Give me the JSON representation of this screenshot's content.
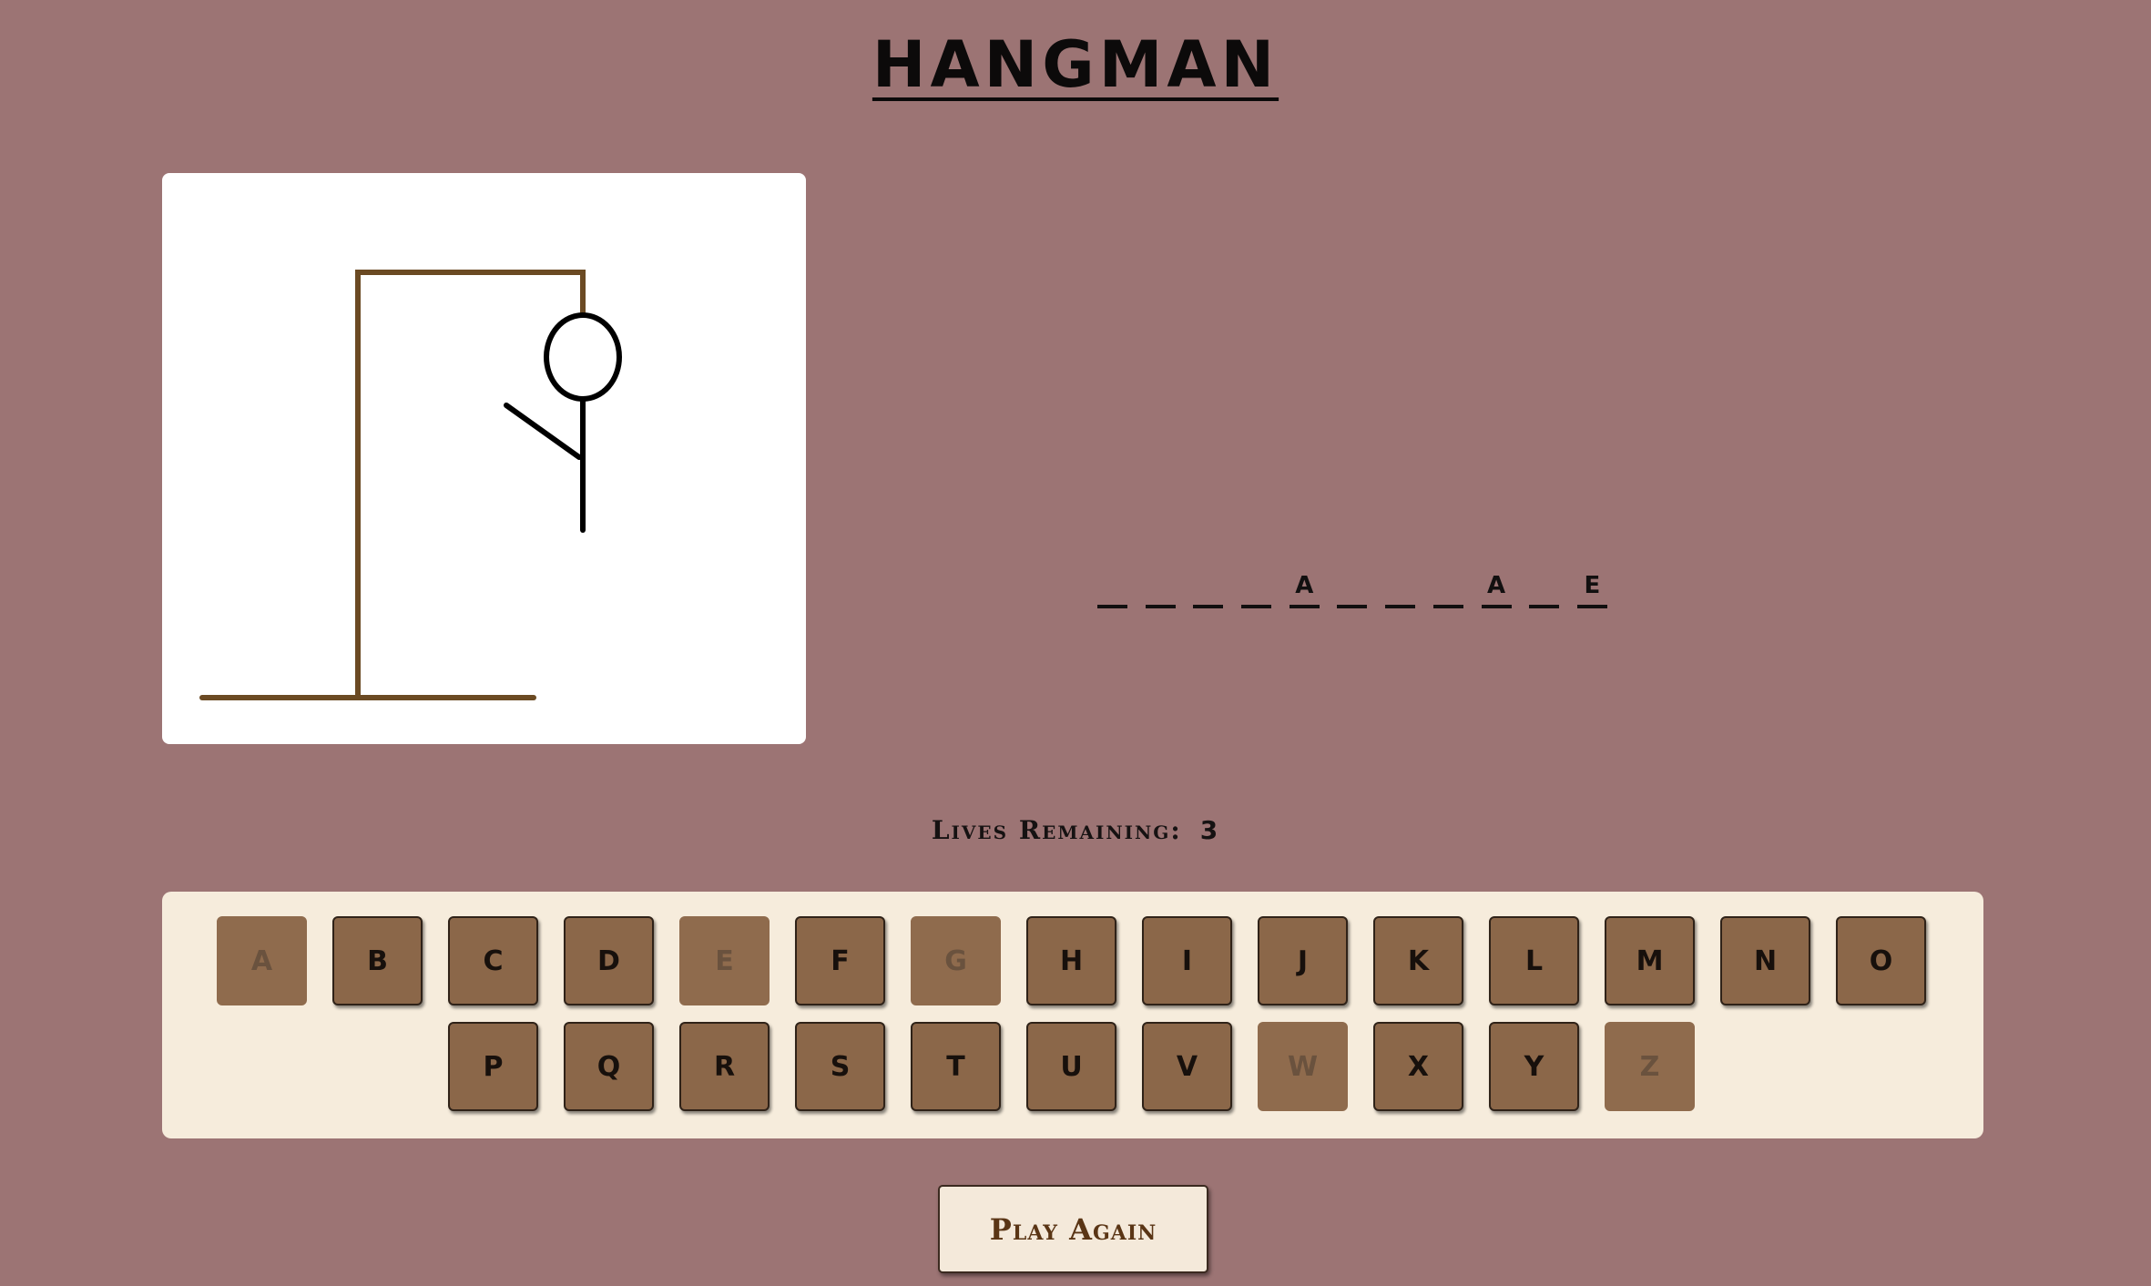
{
  "title": "HANGMAN",
  "word_slots": [
    "",
    "",
    "",
    "",
    "A",
    "",
    "",
    "",
    "A",
    "",
    "E"
  ],
  "lives": {
    "label": "Lives Remaining:",
    "count": "3"
  },
  "keyboard": {
    "row1": [
      {
        "letter": "A",
        "used": true
      },
      {
        "letter": "B",
        "used": false
      },
      {
        "letter": "C",
        "used": false
      },
      {
        "letter": "D",
        "used": false
      },
      {
        "letter": "E",
        "used": true
      },
      {
        "letter": "F",
        "used": false
      },
      {
        "letter": "G",
        "used": true
      },
      {
        "letter": "H",
        "used": false
      },
      {
        "letter": "I",
        "used": false
      },
      {
        "letter": "J",
        "used": false
      },
      {
        "letter": "K",
        "used": false
      },
      {
        "letter": "L",
        "used": false
      },
      {
        "letter": "M",
        "used": false
      },
      {
        "letter": "N",
        "used": false
      },
      {
        "letter": "O",
        "used": false
      }
    ],
    "row2": [
      {
        "letter": "P",
        "used": false
      },
      {
        "letter": "Q",
        "used": false
      },
      {
        "letter": "R",
        "used": false
      },
      {
        "letter": "S",
        "used": false
      },
      {
        "letter": "T",
        "used": false
      },
      {
        "letter": "U",
        "used": false
      },
      {
        "letter": "V",
        "used": false
      },
      {
        "letter": "W",
        "used": true
      },
      {
        "letter": "X",
        "used": false
      },
      {
        "letter": "Y",
        "used": false
      },
      {
        "letter": "Z",
        "used": true
      }
    ]
  },
  "play_again_label": "Play Again",
  "colors": {
    "background": "#9c7474",
    "gallows": "#6b4a23",
    "figure": "#000000",
    "key": "#8b6749",
    "keyboard_panel": "#f6ecdc"
  }
}
